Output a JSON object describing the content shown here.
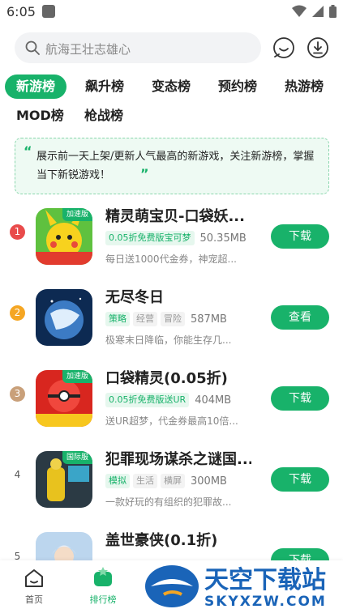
{
  "status_bar": {
    "time": "6:05"
  },
  "search": {
    "placeholder": "航海王壮志雄心"
  },
  "tabs_row1": [
    {
      "label": "新游榜",
      "active": true
    },
    {
      "label": "飙升榜"
    },
    {
      "label": "变态榜"
    },
    {
      "label": "预约榜"
    },
    {
      "label": "热游榜"
    }
  ],
  "tabs_row2": [
    {
      "label": "MOD榜"
    },
    {
      "label": "枪战榜"
    }
  ],
  "notice": {
    "text": "展示前一天上架/更新人气最高的新游戏，关注新游榜，掌握当下新锐游戏！"
  },
  "games": [
    {
      "rank": "1",
      "rank_color": "#e94b4b",
      "badge": "加速版",
      "name": "精灵萌宝贝-口袋妖...",
      "tags": [
        "0.05折免费版宝可梦"
      ],
      "size": "50.35MB",
      "desc": "每日送1000代金券，神宠超...",
      "action": "下载"
    },
    {
      "rank": "2",
      "rank_color": "#f5a623",
      "badge": "",
      "name": "无尽冬日",
      "tags": [
        "策略",
        "经营",
        "冒险"
      ],
      "size": "587MB",
      "desc": "极寒末日降临，你能生存几...",
      "action": "查看"
    },
    {
      "rank": "3",
      "rank_color": "#c9a07a",
      "badge": "加速版",
      "name": "口袋精灵(0.05折)",
      "tags": [
        "0.05折免费版送UR"
      ],
      "size": "404MB",
      "desc": "送UR超梦，代金券最高10倍...",
      "action": "下载"
    },
    {
      "rank": "4",
      "rank_color": "",
      "badge": "国际服",
      "name": "犯罪现场谋杀之谜国...",
      "tags": [
        "模拟",
        "生活",
        "横屏"
      ],
      "size": "300MB",
      "desc": "一款好玩的有组织的犯罪故...",
      "action": "下载"
    },
    {
      "rank": "5",
      "rank_color": "",
      "badge": "",
      "name": "盖世豪侠(0.1折)",
      "tags": [],
      "size": "",
      "desc": "",
      "action": "下载"
    }
  ],
  "bottom_nav": [
    {
      "label": "首页"
    },
    {
      "label": "排行榜",
      "active": true
    }
  ],
  "watermark": {
    "title": "天空下载站",
    "url": "SKYXZW.COM"
  },
  "colors": {
    "accent": "#18b26a"
  }
}
